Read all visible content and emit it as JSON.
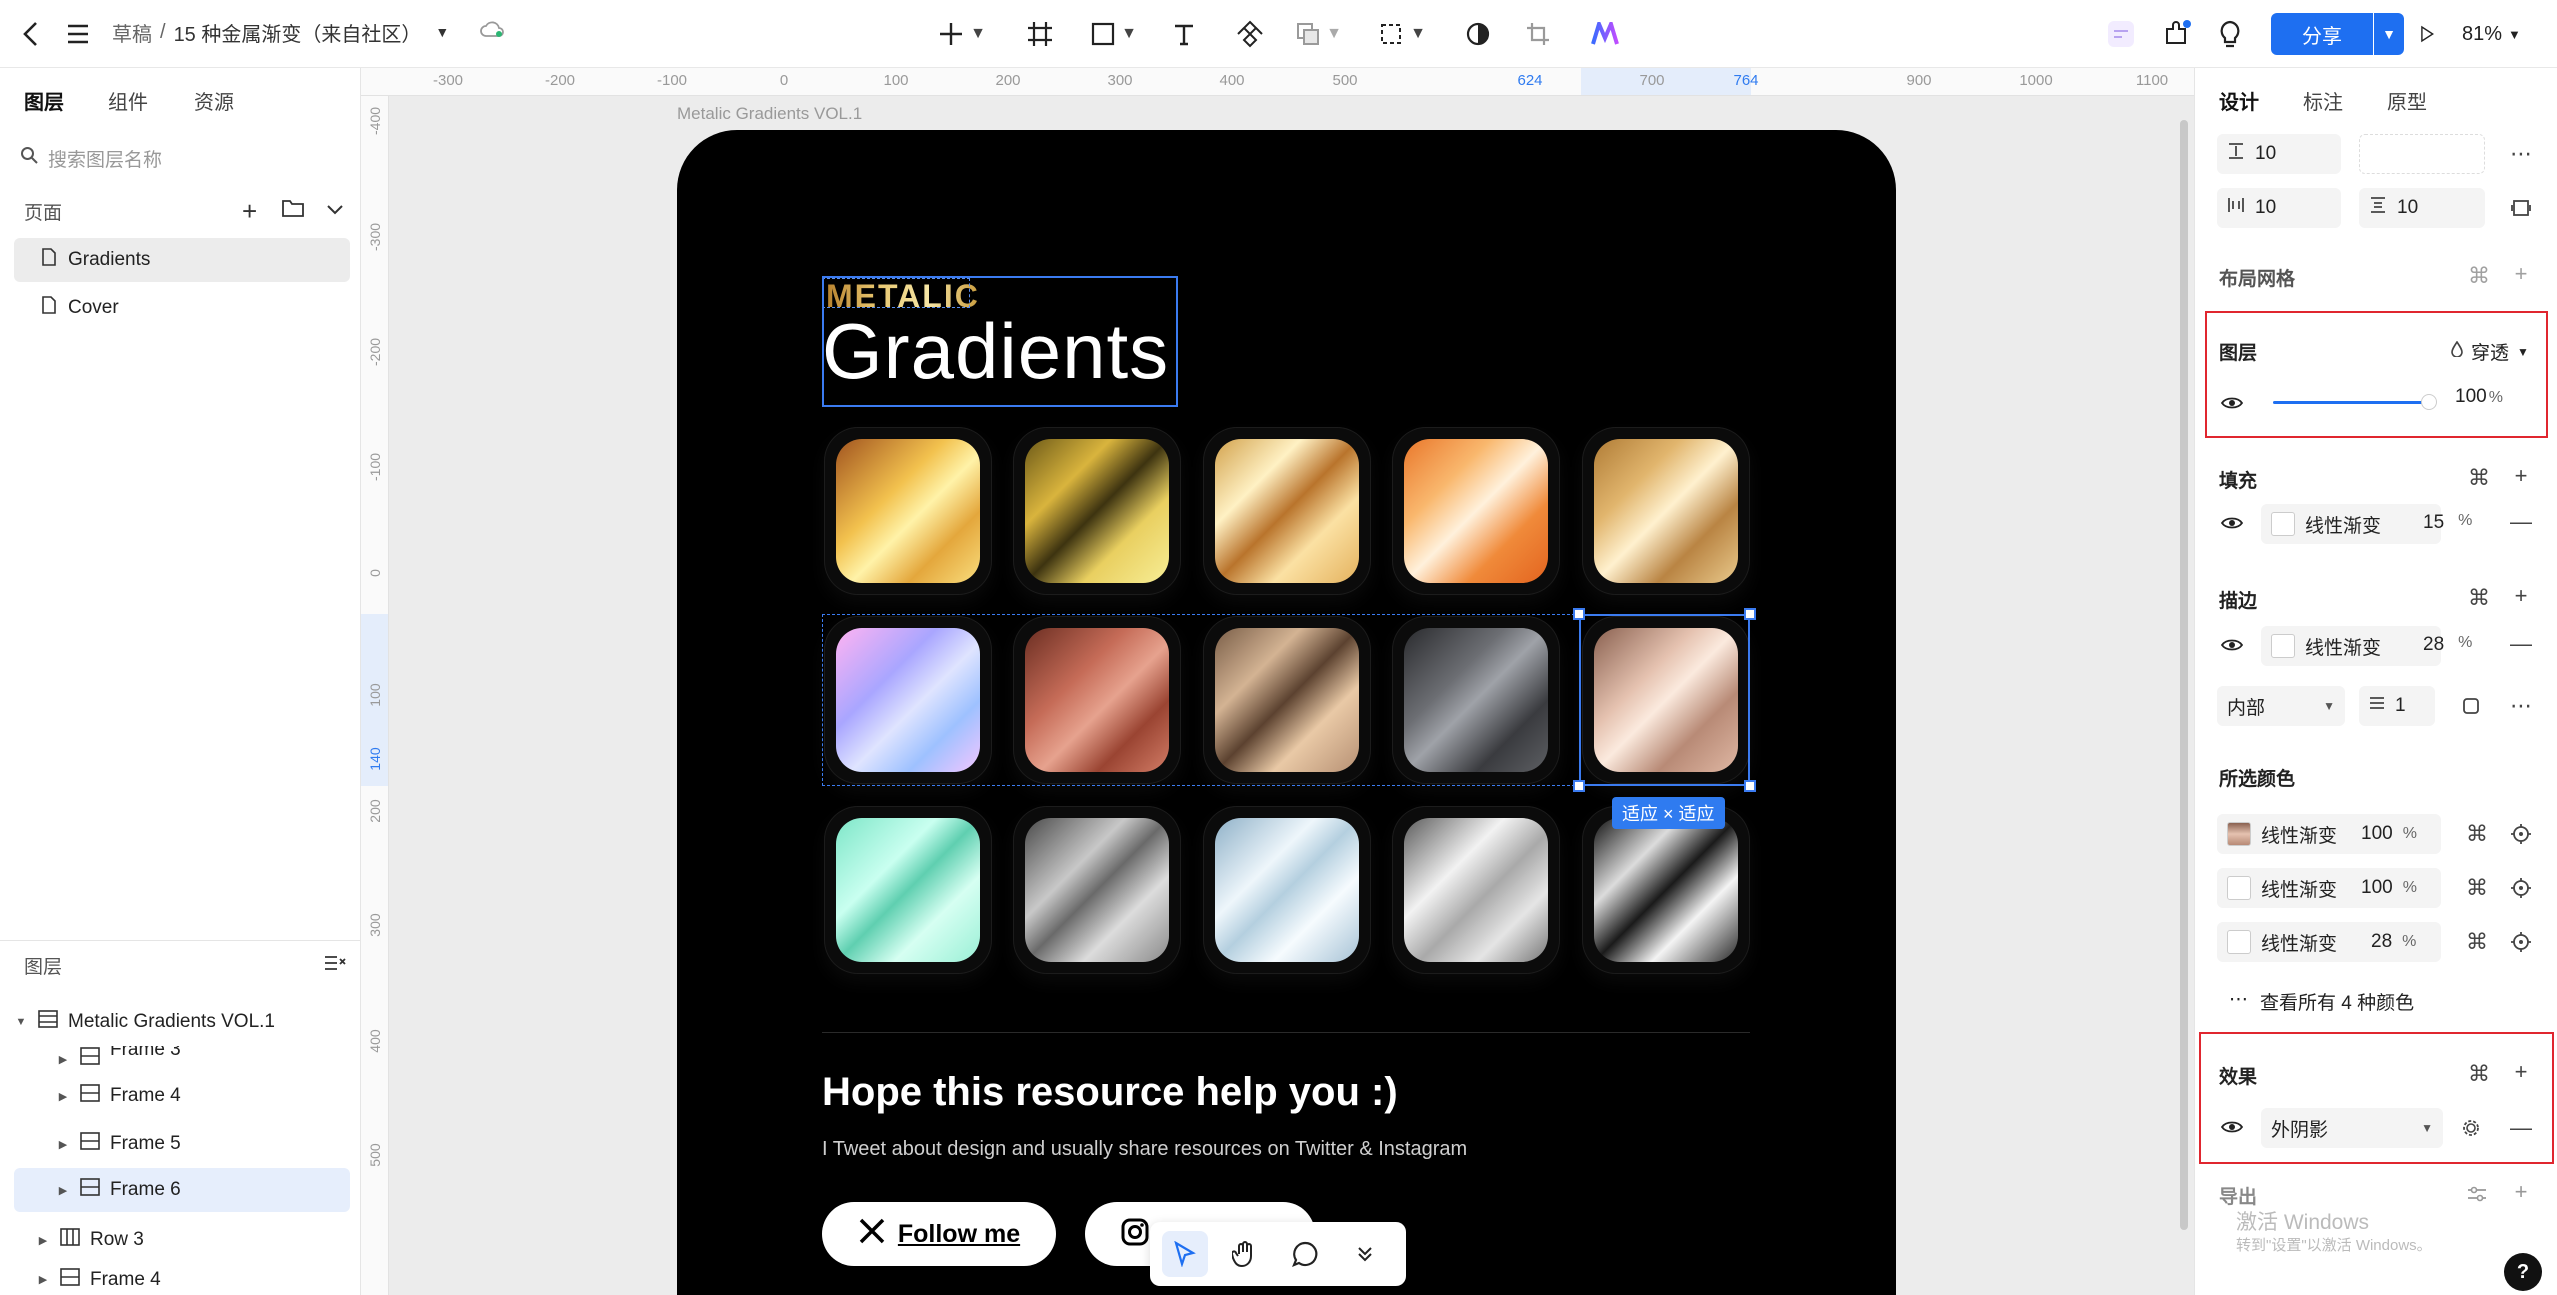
{
  "topbar": {
    "breadcrumb_root": "草稿",
    "breadcrumb_sep": "/",
    "file_name": "15 种金属渐变（来自社区）",
    "share_label": "分享",
    "zoom": "81%"
  },
  "left_panel": {
    "tabs": [
      "图层",
      "组件",
      "资源"
    ],
    "search_placeholder": "搜索图层名称",
    "pages_title": "页面",
    "pages": [
      "Gradients",
      "Cover"
    ],
    "layers_title": "图层",
    "layers": [
      {
        "name": "Metalic Gradients VOL.1"
      },
      {
        "name": "Frame 3"
      },
      {
        "name": "Frame 4"
      },
      {
        "name": "Frame 5"
      },
      {
        "name": "Frame 6"
      },
      {
        "name": "Row 3"
      },
      {
        "name": "Frame 4"
      }
    ]
  },
  "rulers": {
    "top": [
      "-300",
      "-200",
      "-100",
      "0",
      "100",
      "200",
      "300",
      "400",
      "500",
      "624",
      "700",
      "764",
      "900",
      "1000",
      "1100"
    ],
    "left": [
      "-400",
      "-300",
      "-200",
      "-100",
      "0",
      "100",
      "140",
      "200",
      "300",
      "400",
      "500"
    ]
  },
  "canvas": {
    "frame_label": "Metalic Gradients VOL.1",
    "metalic_text": "METALIC",
    "title": "Gradients",
    "size_badge": "适应 × 适应",
    "hope_text": "Hope this resource help you :)",
    "tweet_text": "I Tweet about design and usually share resources on Twitter & Instagram",
    "follow_label": "Follow me",
    "tiles": [
      "linear-gradient(135deg,#a1541f 0%,#f2c14e 38%,#fff2a8 55%,#e4a73c 75%,#f9dd7d 100%)",
      "linear-gradient(135deg,#6d5a18 0%,#d9b43d 30%,#3d3310 50%,#e9cf60 70%,#f7ee96 100%)",
      "linear-gradient(135deg,#d2a24d 0%,#fff1c4 30%,#b9742c 50%,#fbe1a3 70%,#e4b25e 100%)",
      "linear-gradient(135deg,#e9772b 0%,#f9b76d 30%,#fff1dc 50%,#f08a3a 72%,#e3641f 100%)",
      "linear-gradient(135deg,#b07c36 0%,#e1b56d 30%,#fff1cf 50%,#b98443 72%,#e9c98b 100%)",
      "linear-gradient(135deg,#ffb3f2 0%,#a9a6ff 35%,#dfe4ff 55%,#9ec1ff 75%,#f2c6ff 100%)",
      "linear-gradient(135deg,#6b2e22 0%,#c56b57 35%,#e6a28e 55%,#9a4432 75%,#d27c66 100%)",
      "linear-gradient(135deg,#7a5e48 0%,#d3b393 30%,#5c4230 50%,#e9c9a6 70%,#b79174 100%)",
      "linear-gradient(135deg,#2a2b2e 0%,#6c6e73 35%,#9fa2a8 50%,#3a3b3f 75%,#5d5f63 100%)",
      "linear-gradient(135deg,#8a6150 0%,#e5c2b0 35%,#fbeade 50%,#b88a76 72%,#dfb7a3 100%)",
      "linear-gradient(135deg,#7ee6c8 0%,#c9fff0 35%,#5fcfb0 50%,#d6fff2 70%,#9af0d6 100%)",
      "linear-gradient(135deg,#4a4a4a 0%,#c8c8c8 35%,#6a6a6a 50%,#dcdcdc 70%,#8a8a8a 100%)",
      "linear-gradient(135deg,#8fb1c8 0%,#eef6fb 35%,#b4cfdf 50%,#f6fbfe 70%,#a7c3d6 100%)",
      "linear-gradient(135deg,#5b5b5b 0%,#f2f2f2 35%,#a9a9a9 55%,#e5e5e5 75%,#777 100%)",
      "linear-gradient(135deg,#121212 0%,#dcdcdc 30%,#1a1a1a 50%,#f4f4f4 70%,#2a2a2a 100%)"
    ]
  },
  "right_panel": {
    "tabs": [
      "设计",
      "标注",
      "原型"
    ],
    "spacing": {
      "gap_v": "10",
      "pad_left": "10",
      "pad_top": "10"
    },
    "layout_grid_title": "布局网格",
    "layer": {
      "title": "图层",
      "blend": "穿透",
      "opacity": "100"
    },
    "fill": {
      "title": "填充",
      "type": "线性渐变",
      "opacity": "15"
    },
    "stroke": {
      "title": "描边",
      "type": "线性渐变",
      "opacity": "28",
      "position": "内部",
      "width": "1"
    },
    "selected_colors": {
      "title": "所选颜色",
      "items": [
        {
          "type": "线性渐变",
          "opacity": "100"
        },
        {
          "type": "线性渐变",
          "opacity": "100"
        },
        {
          "type": "线性渐变",
          "opacity": "28"
        }
      ],
      "view_all": "查看所有 4 种颜色"
    },
    "effects": {
      "title": "效果",
      "type": "外阴影"
    },
    "export_title": "导出",
    "percent": "%"
  },
  "watermark": {
    "line1": "激活 Windows",
    "line2": "转到\"设置\"以激活 Windows。"
  },
  "help_label": "?",
  "accent_color": "#1e6ff1",
  "highlight_color": "#e0262f"
}
